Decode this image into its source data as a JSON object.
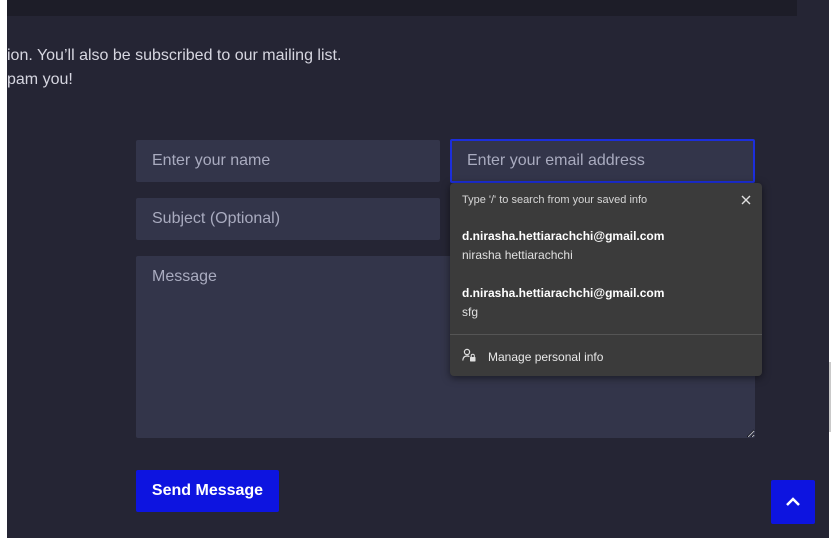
{
  "intro": {
    "line1": "ion. You’ll also be subscribed to our mailing list.",
    "line2": "pam you!"
  },
  "form": {
    "name_placeholder": "Enter your name",
    "email_placeholder": "Enter your email address",
    "subject_placeholder": "Subject (Optional)",
    "message_placeholder": "Message",
    "send_label": "Send Message"
  },
  "autofill": {
    "hint": "Type '/' to search from your saved info",
    "items": [
      {
        "primary": "d.nirasha.hettiarachchi@gmail.com",
        "secondary": "nirasha hettiarachchi"
      },
      {
        "primary": "d.nirasha.hettiarachchi@gmail.com",
        "secondary": "sfg"
      }
    ],
    "manage_label": "Manage personal info"
  },
  "colors": {
    "background": "#252534",
    "field": "#33354a",
    "accent": "#0d14e0",
    "popup": "#3b3b3b"
  },
  "icons": {
    "close": "close-icon",
    "manage": "person-lock-icon",
    "scroll_top": "chevron-up-icon"
  }
}
